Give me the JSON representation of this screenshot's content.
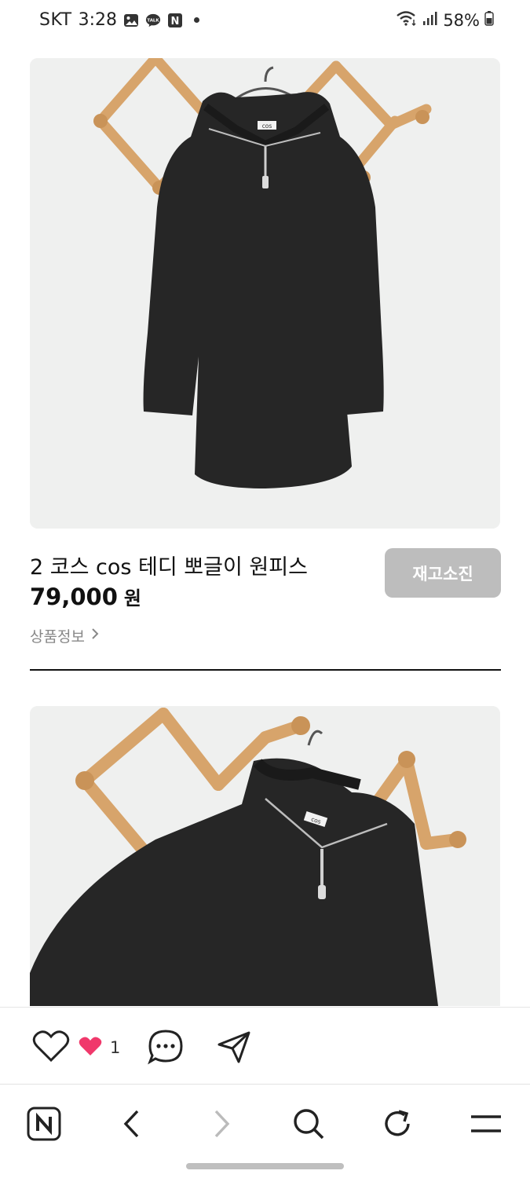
{
  "status_bar": {
    "carrier": "SKT",
    "time": "3:28",
    "talk_badge": "TALK",
    "naver_badge": "N",
    "battery": "58%"
  },
  "product": {
    "title": "2 코스 cos 테디 뽀글이 원피스",
    "price": "79,000",
    "price_unit": "원",
    "sold_out_label": "재고소진",
    "detail_link_label": "상품정보",
    "garment_label": "cos"
  },
  "reactions": {
    "like_count": "1"
  },
  "colors": {
    "sold_out_bg": "#bdbdbd",
    "heart_pink": "#f0386b",
    "wall": "#eff0ef",
    "garment": "#262626",
    "wood": "#d7a46b"
  },
  "browser_nav": {
    "icons": [
      "naver-home-icon",
      "back-icon",
      "forward-icon",
      "search-icon",
      "refresh-icon",
      "menu-icon"
    ]
  }
}
